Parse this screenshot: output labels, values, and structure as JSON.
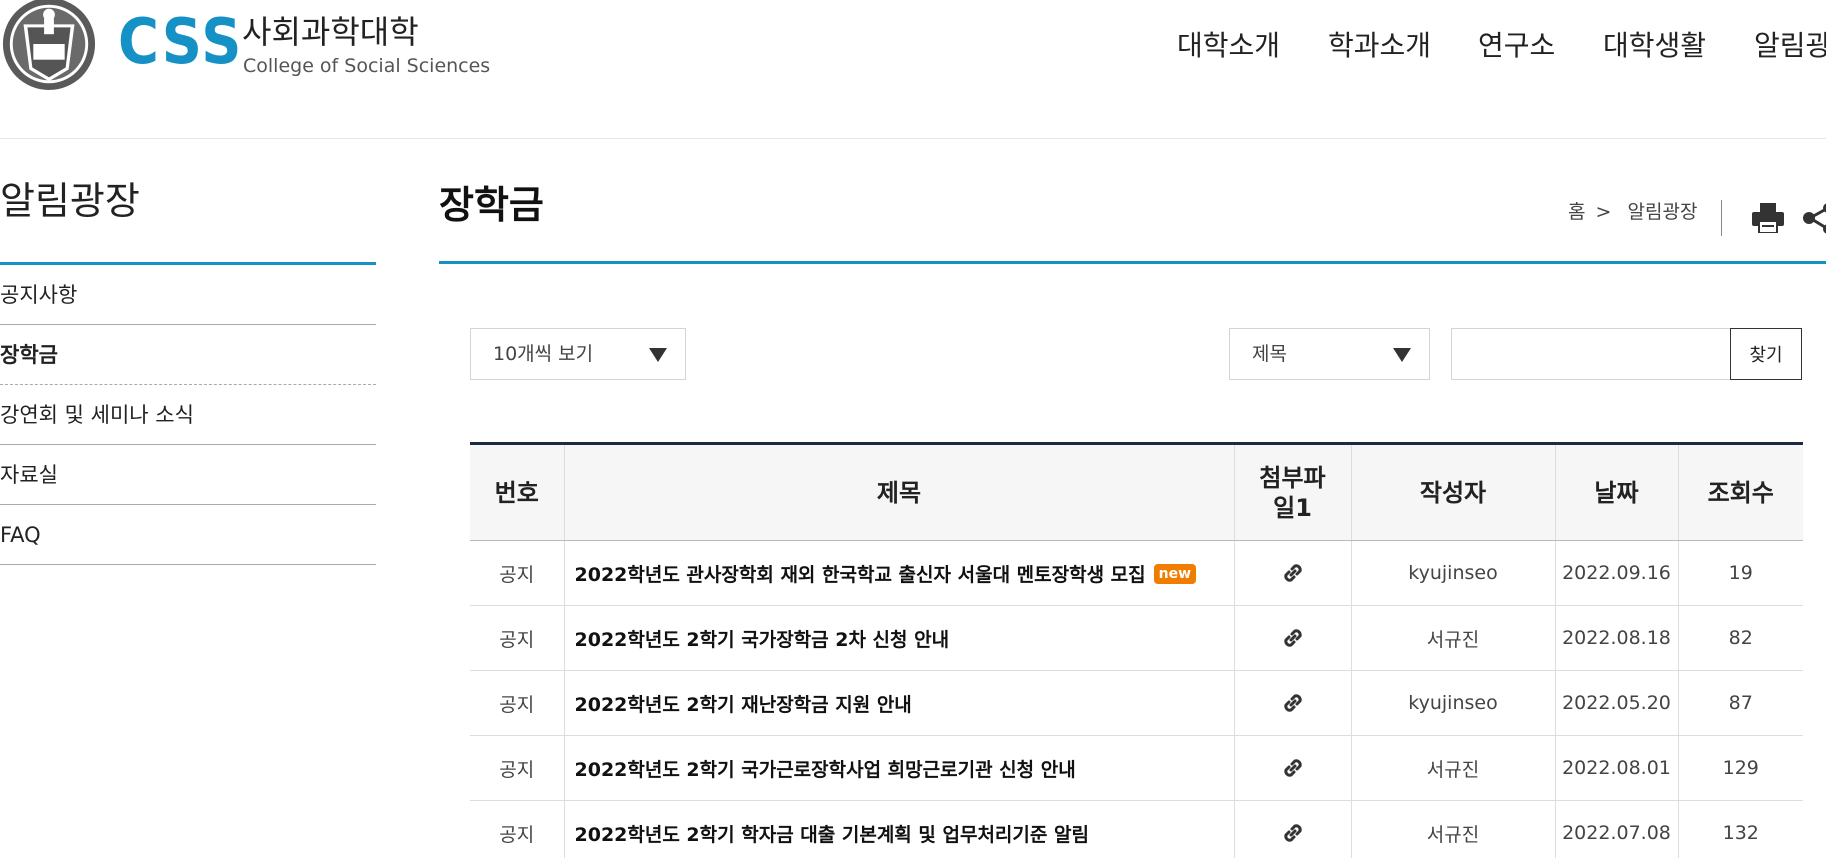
{
  "header": {
    "seal_text": "VERITAS LUX MEA",
    "logo_text": "CSS",
    "college_ko": "사회과학대학",
    "college_en": "College of Social Sciences",
    "nav": [
      "대학소개",
      "학과소개",
      "연구소",
      "대학생활",
      "알림광장"
    ]
  },
  "sidebar": {
    "title": "알림광장",
    "items": [
      {
        "label": "공지사항",
        "active": false
      },
      {
        "label": "장학금",
        "active": true
      },
      {
        "label": "강연회 및 세미나 소식",
        "active": false
      },
      {
        "label": "자료실",
        "active": false
      },
      {
        "label": "FAQ",
        "active": false
      }
    ]
  },
  "content": {
    "title": "장학금",
    "breadcrumb": {
      "home": "홈",
      "sep": ">",
      "current": "알림광장"
    },
    "icons": [
      "print-icon",
      "share-icon"
    ]
  },
  "controls": {
    "page_size": "10개씩 보기",
    "search_field": "제목",
    "search_value": "",
    "search_button": "찾기"
  },
  "table": {
    "headers": [
      "번호",
      "제목",
      "첨부파일1",
      "작성자",
      "날짜",
      "조회수"
    ],
    "rows": [
      {
        "no": "공지",
        "title": "2022학년도 관사장학회 재외 한국학교 출신자 서울대 멘토장학생 모집",
        "badge": "new",
        "author": "kyujinseo",
        "date": "2022.09.16",
        "views": "19"
      },
      {
        "no": "공지",
        "title": "2022학년도 2학기 국가장학금 2차 신청 안내",
        "badge": "",
        "author": "서규진",
        "date": "2022.08.18",
        "views": "82"
      },
      {
        "no": "공지",
        "title": "2022학년도 2학기 재난장학금 지원 안내",
        "badge": "",
        "author": "kyujinseo",
        "date": "2022.05.20",
        "views": "87"
      },
      {
        "no": "공지",
        "title": "2022학년도 2학기 국가근로장학사업 희망근로기관 신청 안내",
        "badge": "",
        "author": "서규진",
        "date": "2022.08.01",
        "views": "129"
      },
      {
        "no": "공지",
        "title": "2022학년도 2학기 학자금 대출 기본계획 및 업무처리기준 알림",
        "badge": "",
        "author": "서규진",
        "date": "2022.07.08",
        "views": "132"
      }
    ]
  },
  "colors": {
    "accent": "#1591c6",
    "table_top": "#1c2a44",
    "badge": "#f07c00"
  }
}
